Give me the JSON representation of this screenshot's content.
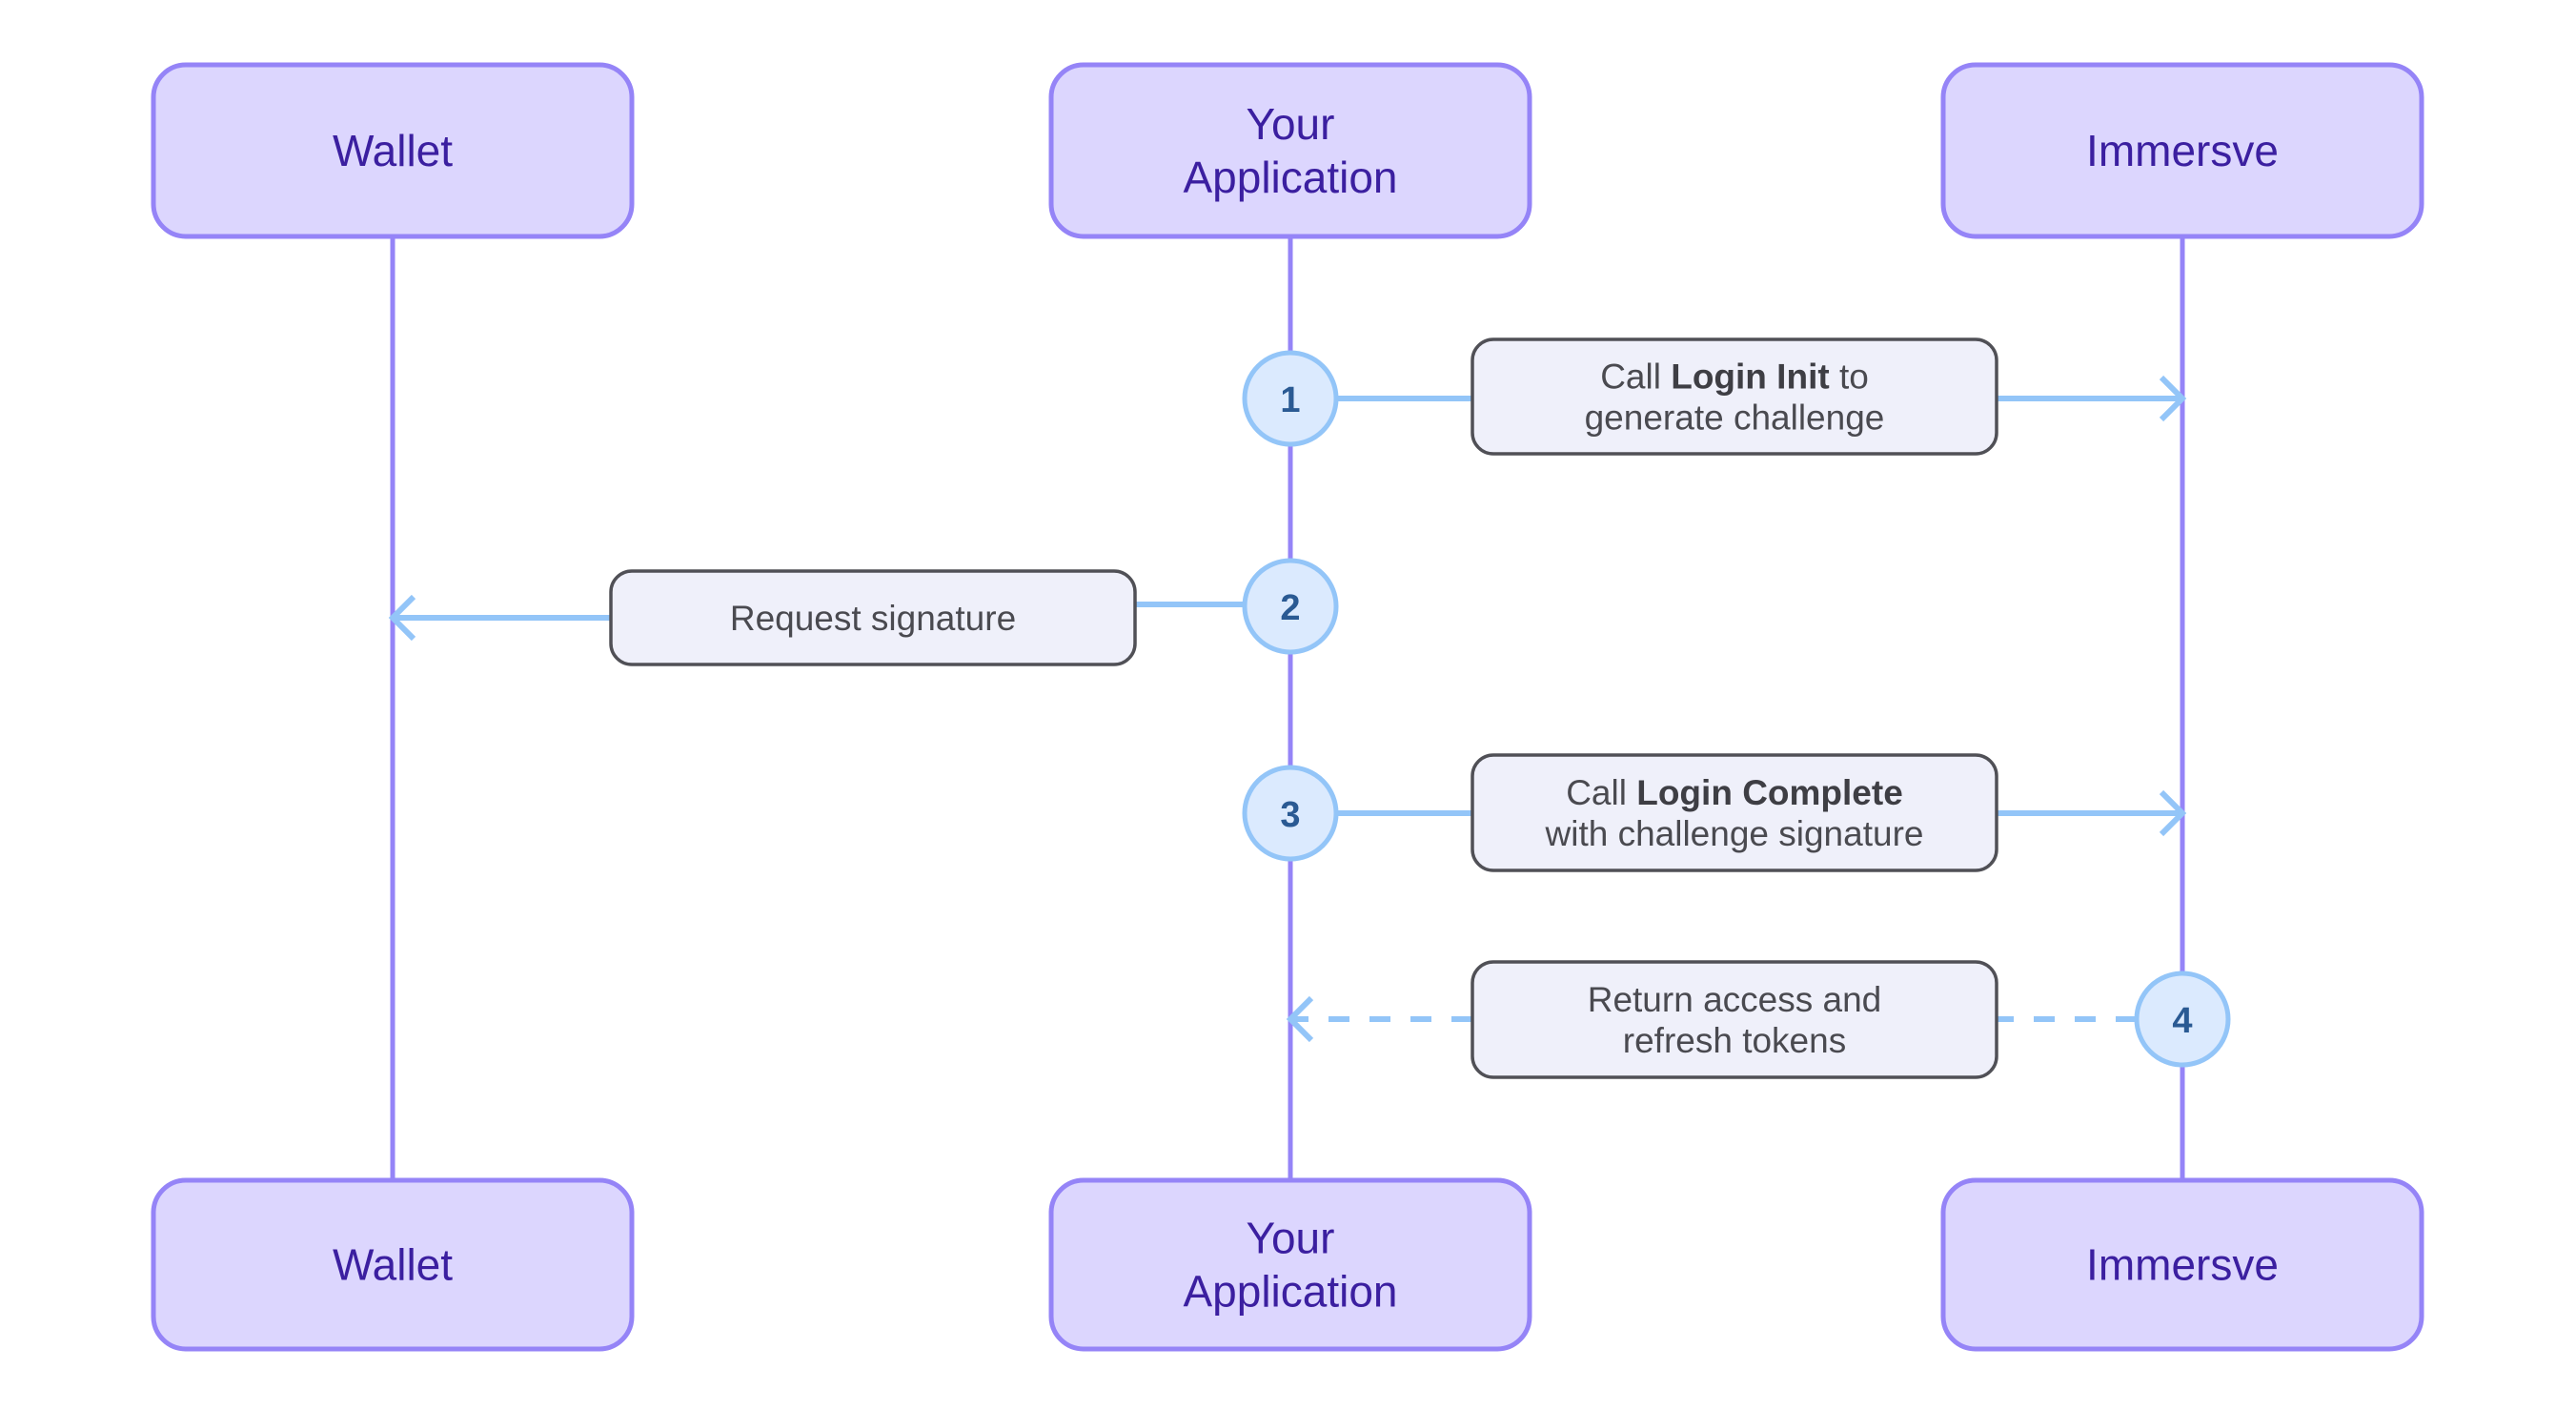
{
  "diagram": {
    "type": "sequence-diagram",
    "colors": {
      "actor_fill": "#dcd6fe",
      "actor_border": "#9584f7",
      "actor_text": "#3b1fa0",
      "lifeline": "#9584f7",
      "message_line": "#93c5f8",
      "note_fill": "#eff0fa",
      "note_border": "#505056",
      "note_text": "#4a4a50",
      "step_fill": "#dbeafe",
      "step_border": "#93c5f8",
      "step_text": "#2a5a93"
    },
    "actors": [
      {
        "id": "wallet",
        "label_lines": [
          "Wallet"
        ]
      },
      {
        "id": "app",
        "label_lines": [
          "Your",
          "Application"
        ]
      },
      {
        "id": "immersve",
        "label_lines": [
          "Immersve"
        ]
      }
    ],
    "messages": [
      {
        "step": "1",
        "from": "app",
        "to": "immersve",
        "style": "solid",
        "label_lines": [
          [
            {
              "text": "Call "
            },
            {
              "text": "Login Init",
              "bold": true
            },
            {
              "text": " to"
            }
          ],
          [
            {
              "text": "generate challenge"
            }
          ]
        ]
      },
      {
        "step": "2",
        "from": "app",
        "to": "wallet",
        "style": "solid",
        "label_lines": [
          [
            {
              "text": "Request signature"
            }
          ]
        ]
      },
      {
        "step": "3",
        "from": "app",
        "to": "immersve",
        "style": "solid",
        "label_lines": [
          [
            {
              "text": "Call "
            },
            {
              "text": "Login Complete",
              "bold": true
            }
          ],
          [
            {
              "text": "with challenge signature"
            }
          ]
        ]
      },
      {
        "step": "4",
        "from": "immersve",
        "to": "app",
        "style": "dashed",
        "label_lines": [
          [
            {
              "text": "Return access and"
            }
          ],
          [
            {
              "text": "refresh tokens"
            }
          ]
        ]
      }
    ]
  }
}
